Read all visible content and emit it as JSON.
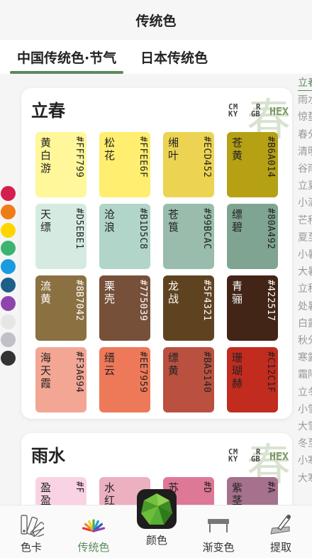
{
  "header": {
    "title": "传统色"
  },
  "tabs": [
    {
      "label": "中国传统色·节气",
      "active": true
    },
    {
      "label": "日本传统色",
      "active": false
    }
  ],
  "mode_labels": {
    "cmyk_top": "CM",
    "cmyk_bottom": "KY",
    "rgb_top": "R",
    "rgb_bottom": "GB",
    "hex": "HEX"
  },
  "cards": [
    {
      "title": "立春",
      "bg_char": "春",
      "colors": [
        {
          "name": "黄白游",
          "hex": "#FFF799",
          "color": "#FFF799",
          "text": "#222222"
        },
        {
          "name": "松花",
          "hex": "#FFEE6F",
          "color": "#FFEE6F",
          "text": "#222222"
        },
        {
          "name": "缃叶",
          "hex": "#ECD452",
          "color": "#ECD452",
          "text": "#222222"
        },
        {
          "name": "苍黄",
          "hex": "#B6A014",
          "color": "#B6A014",
          "text": "#222222"
        },
        {
          "name": "天缥",
          "hex": "#D5EBE1",
          "color": "#D5EBE1",
          "text": "#222222"
        },
        {
          "name": "沧浪",
          "hex": "#B1D5C8",
          "color": "#B1D5C8",
          "text": "#222222"
        },
        {
          "name": "苍筤",
          "hex": "#99BCAC",
          "color": "#99BCAC",
          "text": "#222222"
        },
        {
          "name": "缥碧",
          "hex": "#80A492",
          "color": "#80A492",
          "text": "#222222"
        },
        {
          "name": "流黄",
          "hex": "#8B7042",
          "color": "#8B7042",
          "text": "#ffffff"
        },
        {
          "name": "栗壳",
          "hex": "#775039",
          "color": "#775039",
          "text": "#ffffff"
        },
        {
          "name": "龙战",
          "hex": "#5F4321",
          "color": "#5F4321",
          "text": "#ffffff"
        },
        {
          "name": "青骊",
          "hex": "#422517",
          "color": "#422517",
          "text": "#ffffff"
        },
        {
          "name": "海天霞",
          "hex": "#F3A694",
          "color": "#F3A694",
          "text": "#222222"
        },
        {
          "name": "缙云",
          "hex": "#EE7959",
          "color": "#EE7959",
          "text": "#222222"
        },
        {
          "name": "缥黄",
          "hex": "#BA5140",
          "color": "#BA5140",
          "text": "#222222"
        },
        {
          "name": "珊瑚赫",
          "hex": "#C12C1F",
          "color": "#C12C1F",
          "text": "#222222"
        }
      ]
    },
    {
      "title": "雨水",
      "bg_char": "春",
      "colors": [
        {
          "name": "盈盈",
          "hex": "#F",
          "color": "#F9D3E3",
          "text": "#222222"
        },
        {
          "name": "水红",
          "hex": "",
          "color": "#ECB0C1",
          "text": "#222222"
        },
        {
          "name": "苏",
          "hex": "#D",
          "color": "#DE7897",
          "text": "#222222"
        },
        {
          "name": "紫茎",
          "hex": "#A",
          "color": "#A6718C",
          "text": "#222222"
        }
      ]
    }
  ],
  "palette": [
    "#D41F4E",
    "#F07C17",
    "#FFD500",
    "#3CB371",
    "#1A9BE0",
    "#1E5F8A",
    "#8E44AD",
    "#E6E6E6",
    "#C0C0C8",
    "#333333"
  ],
  "solar_terms": [
    {
      "label": "立春",
      "active": true
    },
    {
      "label": "雨水",
      "active": false
    },
    {
      "label": "惊蛰",
      "active": false
    },
    {
      "label": "春分",
      "active": false
    },
    {
      "label": "清明",
      "active": false
    },
    {
      "label": "谷雨",
      "active": false
    },
    {
      "label": "立夏",
      "active": false
    },
    {
      "label": "小满",
      "active": false
    },
    {
      "label": "芒种",
      "active": false
    },
    {
      "label": "夏至",
      "active": false
    },
    {
      "label": "小暑",
      "active": false
    },
    {
      "label": "大暑",
      "active": false
    },
    {
      "label": "立秋",
      "active": false
    },
    {
      "label": "处暑",
      "active": false
    },
    {
      "label": "白露",
      "active": false
    },
    {
      "label": "秋分",
      "active": false
    },
    {
      "label": "寒露",
      "active": false
    },
    {
      "label": "霜降",
      "active": false
    },
    {
      "label": "立冬",
      "active": false
    },
    {
      "label": "小雪",
      "active": false
    },
    {
      "label": "大雪",
      "active": false
    },
    {
      "label": "冬至",
      "active": false
    },
    {
      "label": "小寒",
      "active": false
    },
    {
      "label": "大寒",
      "active": false
    }
  ],
  "nav": [
    {
      "label": "色卡",
      "icon": "swatch-fan-icon",
      "active": false
    },
    {
      "label": "传统色",
      "icon": "color-fan-icon",
      "active": true
    },
    {
      "label": "颜色",
      "icon": "gem-icon",
      "active": false
    },
    {
      "label": "渐变色",
      "icon": "gradient-icon",
      "active": false
    },
    {
      "label": "提取",
      "icon": "eyedropper-icon",
      "active": false
    }
  ]
}
